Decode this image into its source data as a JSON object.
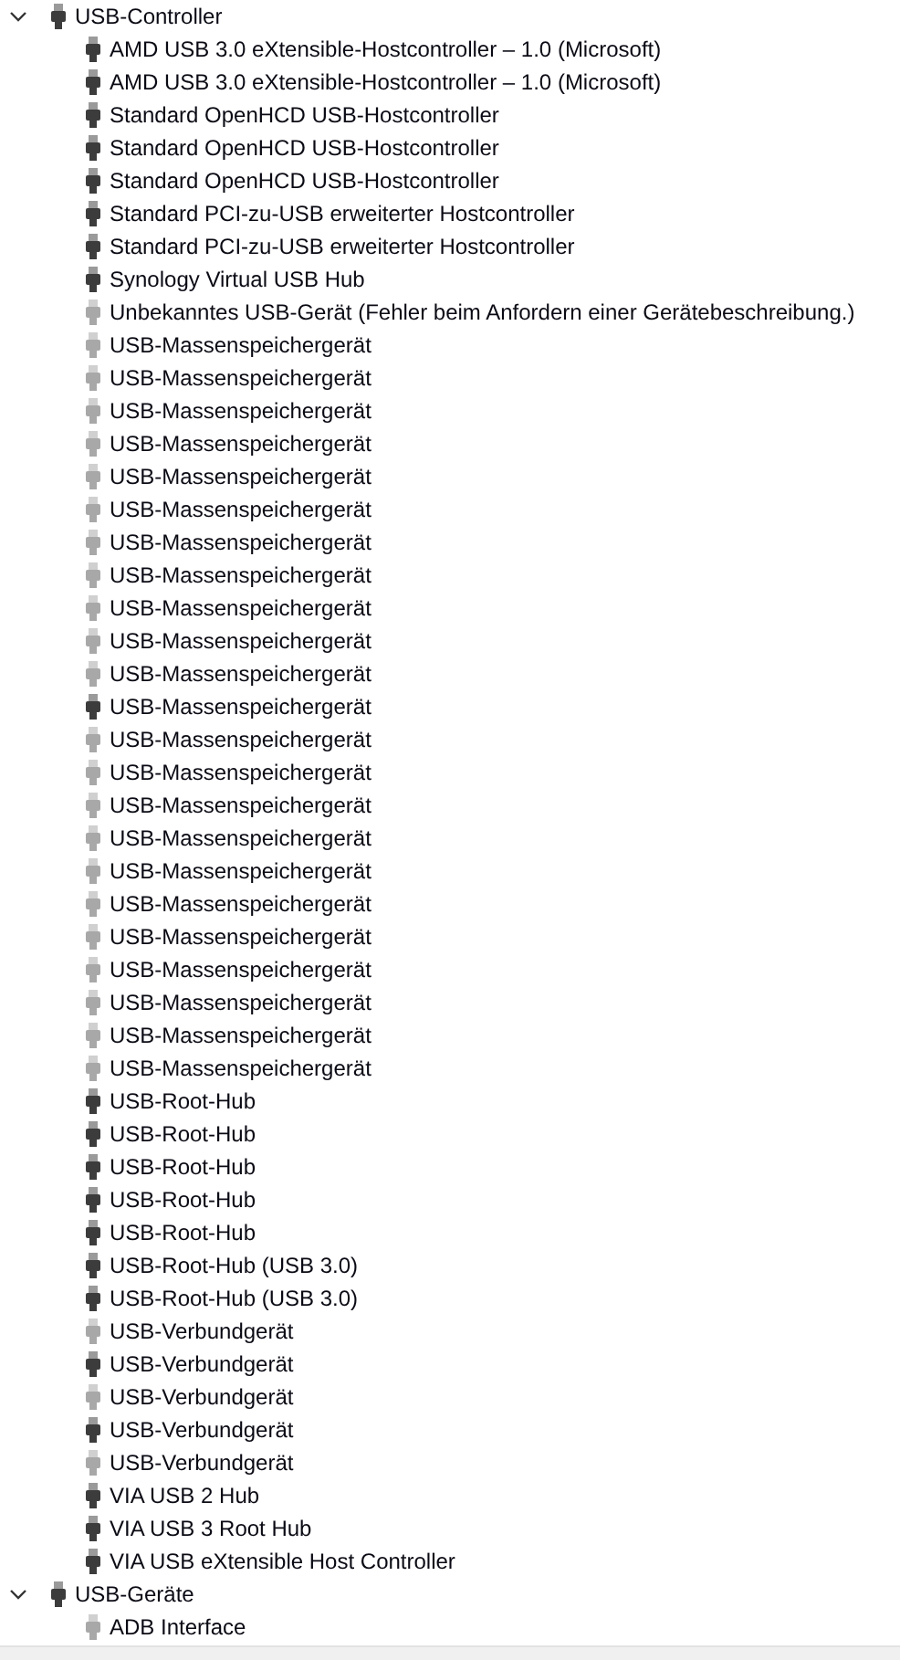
{
  "tree": [
    {
      "label": "USB-Controller",
      "expanded": true,
      "hidden": false,
      "children": [
        {
          "label": "AMD USB 3.0 eXtensible-Hostcontroller – 1.0 (Microsoft)",
          "hidden": false
        },
        {
          "label": "AMD USB 3.0 eXtensible-Hostcontroller – 1.0 (Microsoft)",
          "hidden": false
        },
        {
          "label": "Standard OpenHCD USB-Hostcontroller",
          "hidden": false
        },
        {
          "label": "Standard OpenHCD USB-Hostcontroller",
          "hidden": false
        },
        {
          "label": "Standard OpenHCD USB-Hostcontroller",
          "hidden": false
        },
        {
          "label": "Standard PCI-zu-USB erweiterter Hostcontroller",
          "hidden": false
        },
        {
          "label": "Standard PCI-zu-USB erweiterter Hostcontroller",
          "hidden": false
        },
        {
          "label": "Synology Virtual USB Hub",
          "hidden": false
        },
        {
          "label": "Unbekanntes USB-Gerät (Fehler beim Anfordern einer Gerätebeschreibung.)",
          "hidden": true
        },
        {
          "label": "USB-Massenspeichergerät",
          "hidden": true
        },
        {
          "label": "USB-Massenspeichergerät",
          "hidden": true
        },
        {
          "label": "USB-Massenspeichergerät",
          "hidden": true
        },
        {
          "label": "USB-Massenspeichergerät",
          "hidden": true
        },
        {
          "label": "USB-Massenspeichergerät",
          "hidden": true
        },
        {
          "label": "USB-Massenspeichergerät",
          "hidden": true
        },
        {
          "label": "USB-Massenspeichergerät",
          "hidden": true
        },
        {
          "label": "USB-Massenspeichergerät",
          "hidden": true
        },
        {
          "label": "USB-Massenspeichergerät",
          "hidden": true
        },
        {
          "label": "USB-Massenspeichergerät",
          "hidden": true
        },
        {
          "label": "USB-Massenspeichergerät",
          "hidden": true
        },
        {
          "label": "USB-Massenspeichergerät",
          "hidden": false
        },
        {
          "label": "USB-Massenspeichergerät",
          "hidden": true
        },
        {
          "label": "USB-Massenspeichergerät",
          "hidden": true
        },
        {
          "label": "USB-Massenspeichergerät",
          "hidden": true
        },
        {
          "label": "USB-Massenspeichergerät",
          "hidden": true
        },
        {
          "label": "USB-Massenspeichergerät",
          "hidden": true
        },
        {
          "label": "USB-Massenspeichergerät",
          "hidden": true
        },
        {
          "label": "USB-Massenspeichergerät",
          "hidden": true
        },
        {
          "label": "USB-Massenspeichergerät",
          "hidden": true
        },
        {
          "label": "USB-Massenspeichergerät",
          "hidden": true
        },
        {
          "label": "USB-Massenspeichergerät",
          "hidden": true
        },
        {
          "label": "USB-Massenspeichergerät",
          "hidden": true
        },
        {
          "label": "USB-Root-Hub",
          "hidden": false
        },
        {
          "label": "USB-Root-Hub",
          "hidden": false
        },
        {
          "label": "USB-Root-Hub",
          "hidden": false
        },
        {
          "label": "USB-Root-Hub",
          "hidden": false
        },
        {
          "label": "USB-Root-Hub",
          "hidden": false
        },
        {
          "label": "USB-Root-Hub (USB 3.0)",
          "hidden": false
        },
        {
          "label": "USB-Root-Hub (USB 3.0)",
          "hidden": false
        },
        {
          "label": "USB-Verbundgerät",
          "hidden": true
        },
        {
          "label": "USB-Verbundgerät",
          "hidden": false
        },
        {
          "label": "USB-Verbundgerät",
          "hidden": true
        },
        {
          "label": "USB-Verbundgerät",
          "hidden": false
        },
        {
          "label": "USB-Verbundgerät",
          "hidden": true
        },
        {
          "label": "VIA USB 2 Hub",
          "hidden": false
        },
        {
          "label": "VIA USB 3 Root Hub",
          "hidden": false
        },
        {
          "label": "VIA USB eXtensible Host Controller",
          "hidden": false
        }
      ]
    },
    {
      "label": "USB-Geräte",
      "expanded": true,
      "hidden": false,
      "children": [
        {
          "label": "ADB Interface",
          "hidden": true
        }
      ]
    }
  ]
}
